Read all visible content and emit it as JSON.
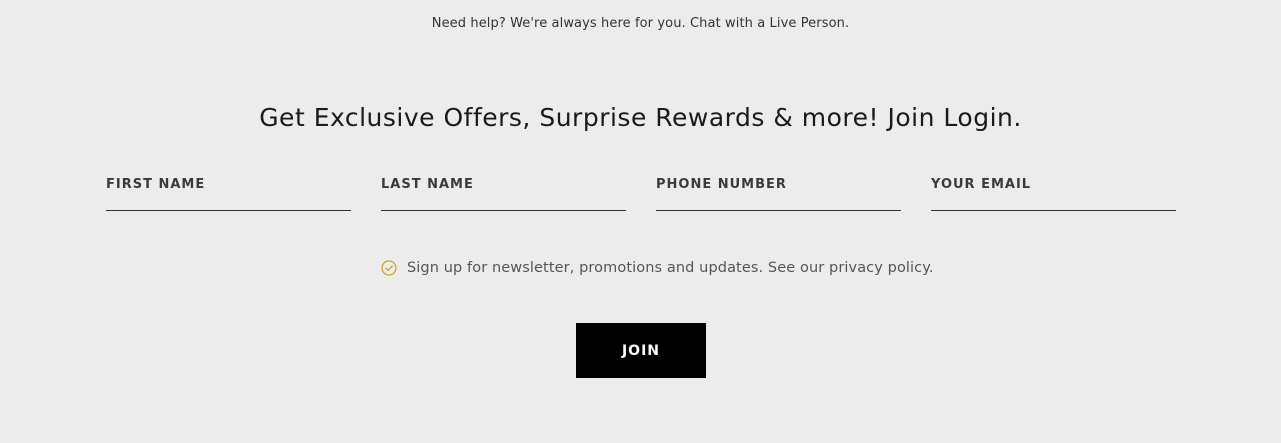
{
  "help": {
    "text": "Need help? We're always here for you. Chat with a Live Person."
  },
  "signup": {
    "headline": "Get Exclusive Offers, Surprise Rewards & more! Join Login.",
    "fields": {
      "first_name": {
        "placeholder": "FIRST NAME",
        "value": ""
      },
      "last_name": {
        "placeholder": "LAST NAME",
        "value": ""
      },
      "phone": {
        "placeholder": "PHONE NUMBER",
        "value": ""
      },
      "email": {
        "placeholder": "YOUR EMAIL",
        "value": ""
      }
    },
    "consent": {
      "label": "Sign up for newsletter, promotions and updates. See our privacy policy.",
      "checked": true,
      "icon": "check-circle-icon",
      "icon_color": "#c9a227"
    },
    "join_label": "JOIN"
  },
  "colors": {
    "background": "#ececec",
    "button_bg": "#000000",
    "button_text": "#ffffff"
  }
}
